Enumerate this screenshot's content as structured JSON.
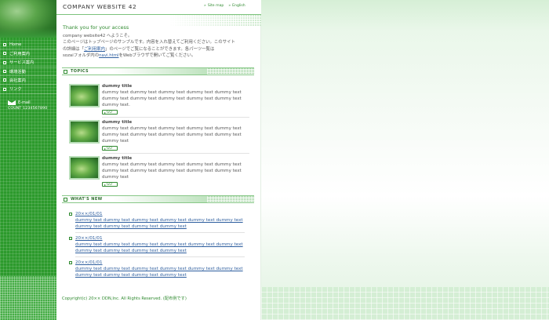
{
  "header": {
    "site_title": "COMPANY WEBSITE 42",
    "links": [
      {
        "label": "Site map",
        "icon": "double-arrow-icon"
      },
      {
        "label": "English",
        "icon": "double-arrow-icon"
      }
    ]
  },
  "sidebar": {
    "items": [
      {
        "label": "Home"
      },
      {
        "label": "ご利用案内"
      },
      {
        "label": "サービス案内"
      },
      {
        "label": "環境活動"
      },
      {
        "label": "会社案内"
      },
      {
        "label": "リンク"
      }
    ],
    "email_label": "E-mail",
    "count": "COUNT 1234567890"
  },
  "welcome": {
    "title": "Thank you for your access",
    "line1": "company website42 へようこそ。",
    "line2": "このページはトップページのサンプルです。内容を入れ替えてご利用ください。このサイト",
    "line3_pre": "の詳細は「",
    "line3_link": "ご利用案内",
    "line3_post": "」のページでご覧になることができます。各パーツ一覧は",
    "line4_pre": "sozaiフォルダ内の",
    "line4_link": "navi.html",
    "line4_post": "をWebブラウザで開いてご覧ください。"
  },
  "topics": {
    "heading": "TOPICS",
    "go_label": "GO",
    "items": [
      {
        "title": "dummy title",
        "body": "dummy text dummy text dummy text dummy text dummy text dummy text dummy text dummy text dummy text dummy text dummy text."
      },
      {
        "title": "dummy title",
        "body": "dummy text dummy text dummy text dummy text dummy text dummy text dummy text dummy text dummy text dummy text dummy text"
      },
      {
        "title": "dummy title",
        "body": "dummy text dummy text dummy text dummy text dummy text dummy text dummy text dummy text dummy text dummy text dummy text"
      }
    ]
  },
  "news": {
    "heading": "WHAT'S NEW",
    "items": [
      {
        "date": "20××/01/01",
        "text": "dummy text dummy text dummy text dummy text dummy text dummy text dummy text dummy text dummy text dummy text"
      },
      {
        "date": "20××/01/01",
        "text": "dummy text dummy text dummy text dummy text dummy text dummy text dummy text dummy text dummy text dummy text"
      },
      {
        "date": "20××/01/01",
        "text": "dummy text dummy text dummy text dummy text dummy text dummy text dummy text dummy text dummy text dummy text"
      }
    ]
  },
  "footer": {
    "copyright": "Copyright(c) 20×× DDN,Inc. All Rights Reserved.",
    "note": "(配布例です)"
  },
  "colors": {
    "accent": "#2f8a2f",
    "sidebar": "#2c9a2c",
    "link": "#2f5f9f"
  }
}
